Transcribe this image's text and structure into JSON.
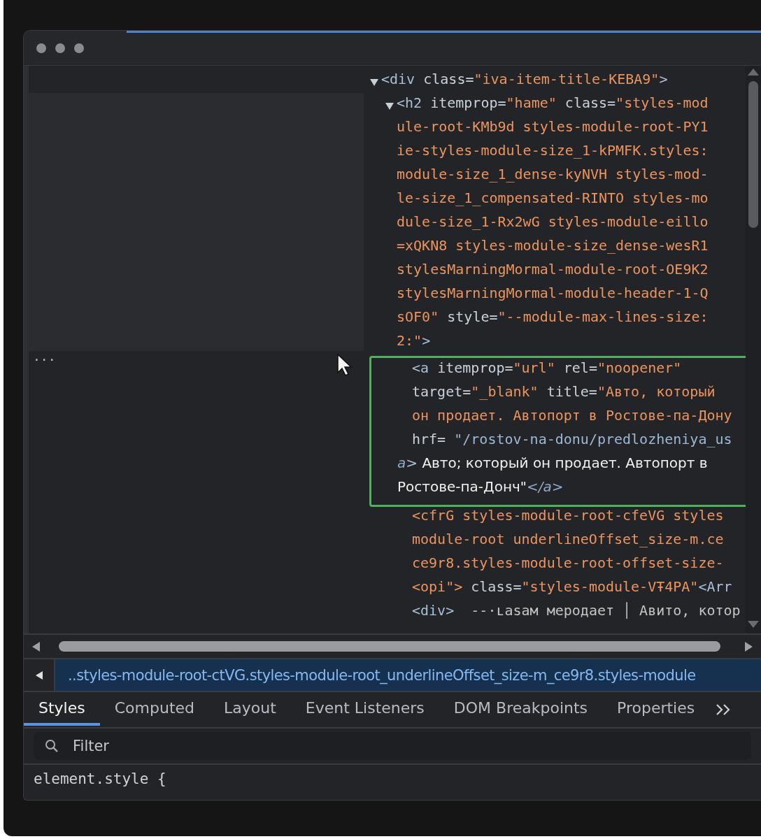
{
  "tree": [
    {
      "expanded": true,
      "highlighted": false,
      "lines": [
        [
          {
            "kind": "tag",
            "text": "<div"
          },
          {
            "kind": "attr",
            "text": " class="
          },
          {
            "kind": "value",
            "text": "\"iva-item-title-KEBA9\""
          },
          {
            "kind": "tag",
            "text": ">"
          }
        ]
      ],
      "children": [
        {
          "expanded": true,
          "highlighted": false,
          "lines": [
            [
              {
                "kind": "tag",
                "text": "<h2"
              },
              {
                "kind": "attr",
                "text": " itemprop="
              },
              {
                "kind": "value",
                "text": "\"hame\""
              },
              {
                "kind": "attr",
                "text": " class="
              },
              {
                "kind": "value",
                "text": "\"styles-mod"
              }
            ],
            [
              {
                "kind": "value",
                "text": "ule-root-KMb9d styles-module-root-PY1"
              }
            ],
            [
              {
                "kind": "value",
                "text": "ie-styles-module-size_1-kPMFK.styles:"
              }
            ],
            [
              {
                "kind": "value",
                "text": "module-size_1_dense-kyNVH styles-mod-"
              }
            ],
            [
              {
                "kind": "value",
                "text": "le-size_1_compensated-RINTO styles-mo"
              }
            ],
            [
              {
                "kind": "value",
                "text": "dule-size_1-Rx2wG styles-module-eillo"
              }
            ],
            [
              {
                "kind": "value",
                "text": "=xQKN8 styles-module-size_dense-wesR1"
              }
            ],
            [
              {
                "kind": "value",
                "text": "stylesMarningMormal-module-root-OE9K2"
              }
            ],
            [
              {
                "kind": "value",
                "text": "stylesMarningMormal-module-header-1-Q"
              }
            ],
            [
              {
                "kind": "value",
                "text": "sOF0\""
              },
              {
                "kind": "attr",
                "text": " style="
              },
              {
                "kind": "value",
                "text": "\"--module-max-lines-size:"
              }
            ],
            [
              {
                "kind": "value",
                "text": "2:\""
              },
              {
                "kind": "tag",
                "text": ">"
              }
            ]
          ],
          "children": [
            {
              "highlighted": true,
              "lines": [
                [
                  {
                    "kind": "tag",
                    "text": "<a"
                  },
                  {
                    "kind": "attr",
                    "text": " itemprop="
                  },
                  {
                    "kind": "value",
                    "text": "\"url\""
                  },
                  {
                    "kind": "attr",
                    "text": " rel="
                  },
                  {
                    "kind": "value",
                    "text": "\"noopener\""
                  }
                ],
                [
                  {
                    "kind": "attr",
                    "text": "target="
                  },
                  {
                    "kind": "value",
                    "text": "\"_blank\""
                  },
                  {
                    "kind": "attr",
                    "text": " title="
                  },
                  {
                    "kind": "value",
                    "text": "\"Авто, который"
                  }
                ],
                [
                  {
                    "kind": "value",
                    "text": "он продает. Автопорт в Ростове-па-Дону"
                  }
                ],
                [
                  {
                    "kind": "attr",
                    "text": "hrf= "
                  },
                  {
                    "kind": "link",
                    "text": "\"/rostov-na-donu/predlozheniya_us"
                  }
                ],
                [
                  {
                    "kind": "italic-tag",
                    "text": "a"
                  },
                  {
                    "kind": "tag",
                    "text": ">"
                  },
                  {
                    "kind": "text",
                    "text": " Авто; который он продает. Автопорт в"
                  }
                ],
                [
                  {
                    "kind": "text",
                    "text": "Ростове-па-Донч\""
                  },
                  {
                    "kind": "italic-tag",
                    "text": "</a>"
                  }
                ]
              ]
            },
            {
              "highlighted": false,
              "lines": [
                [
                  {
                    "kind": "value",
                    "text": "<cfrG styles-module-root-cfeVG styles"
                  }
                ],
                [
                  {
                    "kind": "value",
                    "text": "module-root underlineOffset_size-m.ce"
                  }
                ],
                [
                  {
                    "kind": "value",
                    "text": "ce9r8.styles-module-root-offset-size-"
                  }
                ]
              ]
            },
            {
              "highlighted": false,
              "lines": [
                [
                  {
                    "kind": "value",
                    "text": "<opi\">"
                  },
                  {
                    "kind": "attr",
                    "text": " class="
                  },
                  {
                    "kind": "value",
                    "text": "\"styles-module-VŦ4PA\""
                  },
                  {
                    "kind": "tag",
                    "text": "<Arr"
                  }
                ]
              ]
            },
            {
              "highlighted": false,
              "lines": [
                [
                  {
                    "kind": "tag",
                    "text": "<div>"
                  },
                  {
                    "kind": "plain",
                    "text": "  --·ʟasaм мерoдает │ Авито, котор"
                  }
                ]
              ]
            }
          ]
        }
      ]
    }
  ],
  "gutter_marker": "...",
  "breadcrumb": "..styles-module-root-ctVG.styles-module-root_underlineOffset_size-m_ce9r8.styles-module",
  "tabs": [
    {
      "label": "Styles",
      "selected": true
    },
    {
      "label": "Computed",
      "selected": false
    },
    {
      "label": "Layout",
      "selected": false
    },
    {
      "label": "Event Listeners",
      "selected": false
    },
    {
      "label": "DOM Breakpoints",
      "selected": false
    },
    {
      "label": "Properties",
      "selected": false
    }
  ],
  "filter": {
    "placeholder": "Filter"
  },
  "styles_rule": "element.style {"
}
